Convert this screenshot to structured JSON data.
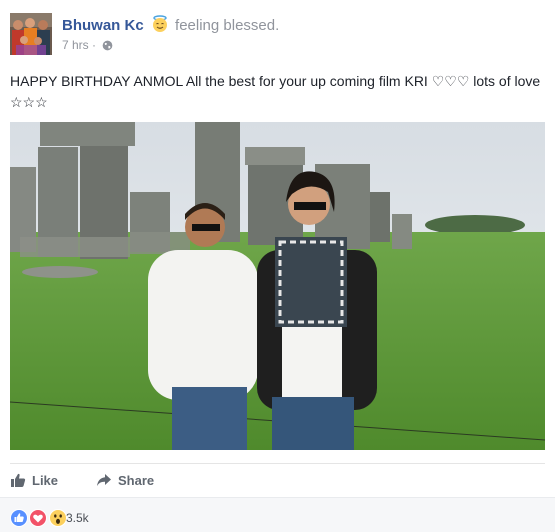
{
  "post": {
    "author": "Bhuwan Kc",
    "feeling": "feeling blessed.",
    "feeling_icon": "smiling-halo-emoji",
    "time": "7 hrs",
    "separator": "·",
    "audience_icon": "globe-icon",
    "text": "HAPPY BIRTHDAY ANMOL All the best for your up coming film KRI ♡♡♡ lots of love ☆☆☆"
  },
  "actions": {
    "like_label": "Like",
    "share_label": "Share"
  },
  "reactions": {
    "icons": [
      "like-reaction-icon",
      "love-reaction-icon",
      "wow-reaction-icon"
    ],
    "count": "3.5k"
  },
  "colors": {
    "author_link": "#365899",
    "secondary_text": "#90949c",
    "action_text": "#606770",
    "like_blue": "#5890ff",
    "love_red": "#f25268",
    "wow_yellow": "#fcd05d"
  }
}
